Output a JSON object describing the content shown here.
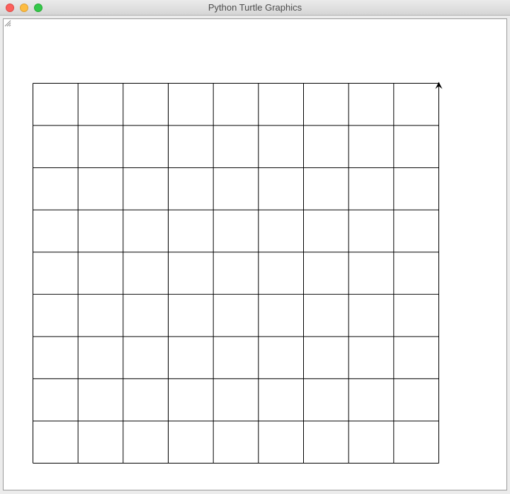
{
  "window": {
    "title": "Python Turtle Graphics"
  },
  "controls": {
    "close": "close-icon",
    "minimize": "minimize-icon",
    "zoom": "zoom-icon"
  },
  "canvas": {
    "background": "#ffffff",
    "line_color": "#000000",
    "grid": {
      "rows": 9,
      "columns": 9
    },
    "turtle": {
      "shape": "classic-arrow",
      "heading": "up",
      "color": "#000000"
    }
  }
}
